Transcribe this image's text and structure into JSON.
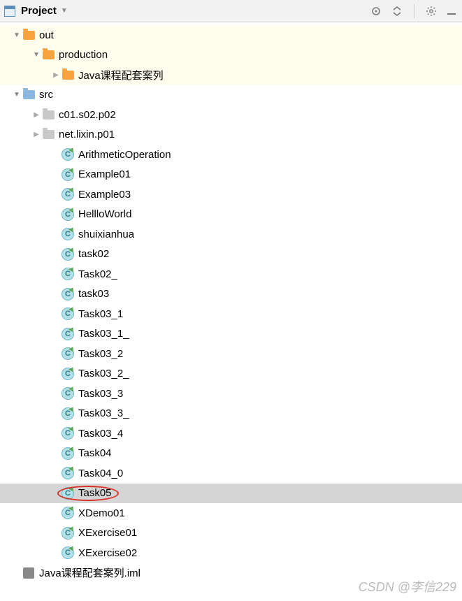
{
  "toolbar": {
    "title": "Project"
  },
  "tree": [
    {
      "depth": 0,
      "arrow": "down",
      "icon": "folder-orange",
      "label": "out",
      "hl": true
    },
    {
      "depth": 1,
      "arrow": "down",
      "icon": "folder-orange",
      "label": "production",
      "hl": true
    },
    {
      "depth": 2,
      "arrow": "right",
      "icon": "folder-orange",
      "label": "Java课程配套案列",
      "hl": true
    },
    {
      "depth": 0,
      "arrow": "down",
      "icon": "folder-blue",
      "label": "src"
    },
    {
      "depth": 1,
      "arrow": "right",
      "icon": "folder-gray",
      "label": "c01.s02.p02"
    },
    {
      "depth": 1,
      "arrow": "right",
      "icon": "folder-gray",
      "label": "net.lixin.p01"
    },
    {
      "depth": 2,
      "arrow": "",
      "icon": "class",
      "label": "ArithmeticOperation"
    },
    {
      "depth": 2,
      "arrow": "",
      "icon": "class",
      "label": "Example01"
    },
    {
      "depth": 2,
      "arrow": "",
      "icon": "class",
      "label": "Example03"
    },
    {
      "depth": 2,
      "arrow": "",
      "icon": "class",
      "label": "HellloWorld"
    },
    {
      "depth": 2,
      "arrow": "",
      "icon": "class",
      "label": "shuixianhua"
    },
    {
      "depth": 2,
      "arrow": "",
      "icon": "class",
      "label": "task02"
    },
    {
      "depth": 2,
      "arrow": "",
      "icon": "class",
      "label": "Task02_"
    },
    {
      "depth": 2,
      "arrow": "",
      "icon": "class",
      "label": "task03"
    },
    {
      "depth": 2,
      "arrow": "",
      "icon": "class",
      "label": "Task03_1"
    },
    {
      "depth": 2,
      "arrow": "",
      "icon": "class",
      "label": "Task03_1_"
    },
    {
      "depth": 2,
      "arrow": "",
      "icon": "class",
      "label": "Task03_2"
    },
    {
      "depth": 2,
      "arrow": "",
      "icon": "class",
      "label": "Task03_2_"
    },
    {
      "depth": 2,
      "arrow": "",
      "icon": "class",
      "label": "Task03_3"
    },
    {
      "depth": 2,
      "arrow": "",
      "icon": "class",
      "label": "Task03_3_"
    },
    {
      "depth": 2,
      "arrow": "",
      "icon": "class",
      "label": "Task03_4"
    },
    {
      "depth": 2,
      "arrow": "",
      "icon": "class",
      "label": "Task04"
    },
    {
      "depth": 2,
      "arrow": "",
      "icon": "class",
      "label": "Task04_0"
    },
    {
      "depth": 2,
      "arrow": "",
      "icon": "class",
      "label": "Task05",
      "sel": true,
      "circled": true
    },
    {
      "depth": 2,
      "arrow": "",
      "icon": "class",
      "label": "XDemo01"
    },
    {
      "depth": 2,
      "arrow": "",
      "icon": "class",
      "label": "XExercise01"
    },
    {
      "depth": 2,
      "arrow": "",
      "icon": "class",
      "label": "XExercise02"
    },
    {
      "depth": 0,
      "arrow": "",
      "icon": "iml",
      "label": "Java课程配套案列.iml"
    }
  ],
  "watermark": "CSDN @李信229"
}
